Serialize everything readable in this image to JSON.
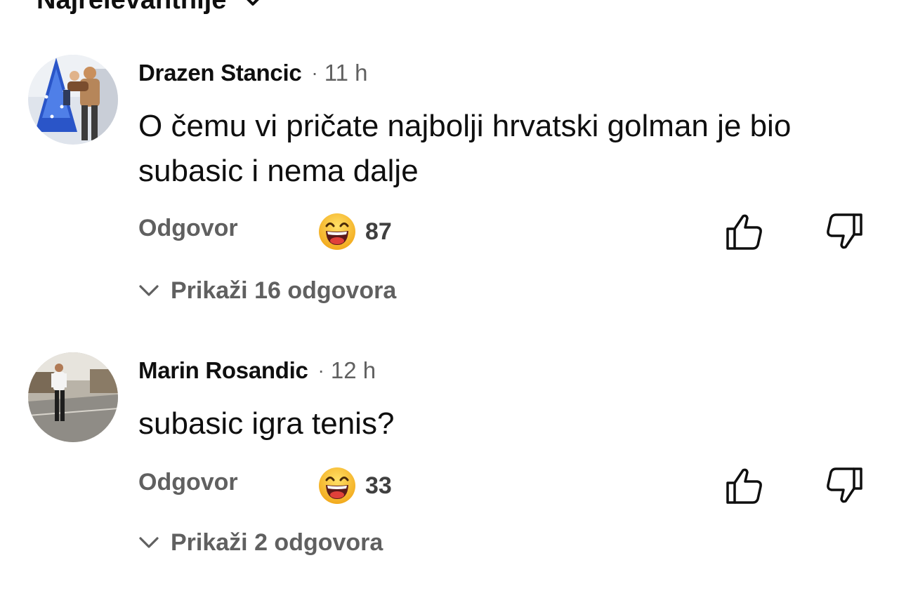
{
  "sort": {
    "label": "Najrelevantnije",
    "icon": "chevron-down-icon"
  },
  "comments": [
    {
      "author": "Drazen Stancic",
      "separator": "·",
      "time": "11 h",
      "text": "O čemu vi pričate najbolji hrvatski golman je bio subasic i nema dalje",
      "reply_label": "Odgovor",
      "reaction_icon": "laughing-emoji-icon",
      "reaction_count": "87",
      "replies_label": "Prikaži 16 odgovora"
    },
    {
      "author": "Marin Rosandic",
      "separator": "·",
      "time": "12 h",
      "text": "subasic igra tenis?",
      "reply_label": "Odgovor",
      "reaction_icon": "laughing-emoji-icon",
      "reaction_count": "33",
      "replies_label": "Prikaži 2 odgovora"
    }
  ],
  "colors": {
    "primary_text": "#0f0f0f",
    "secondary_text": "#606060",
    "emoji_yellow": "#f7c12a",
    "emoji_mouth": "#c8102e"
  }
}
